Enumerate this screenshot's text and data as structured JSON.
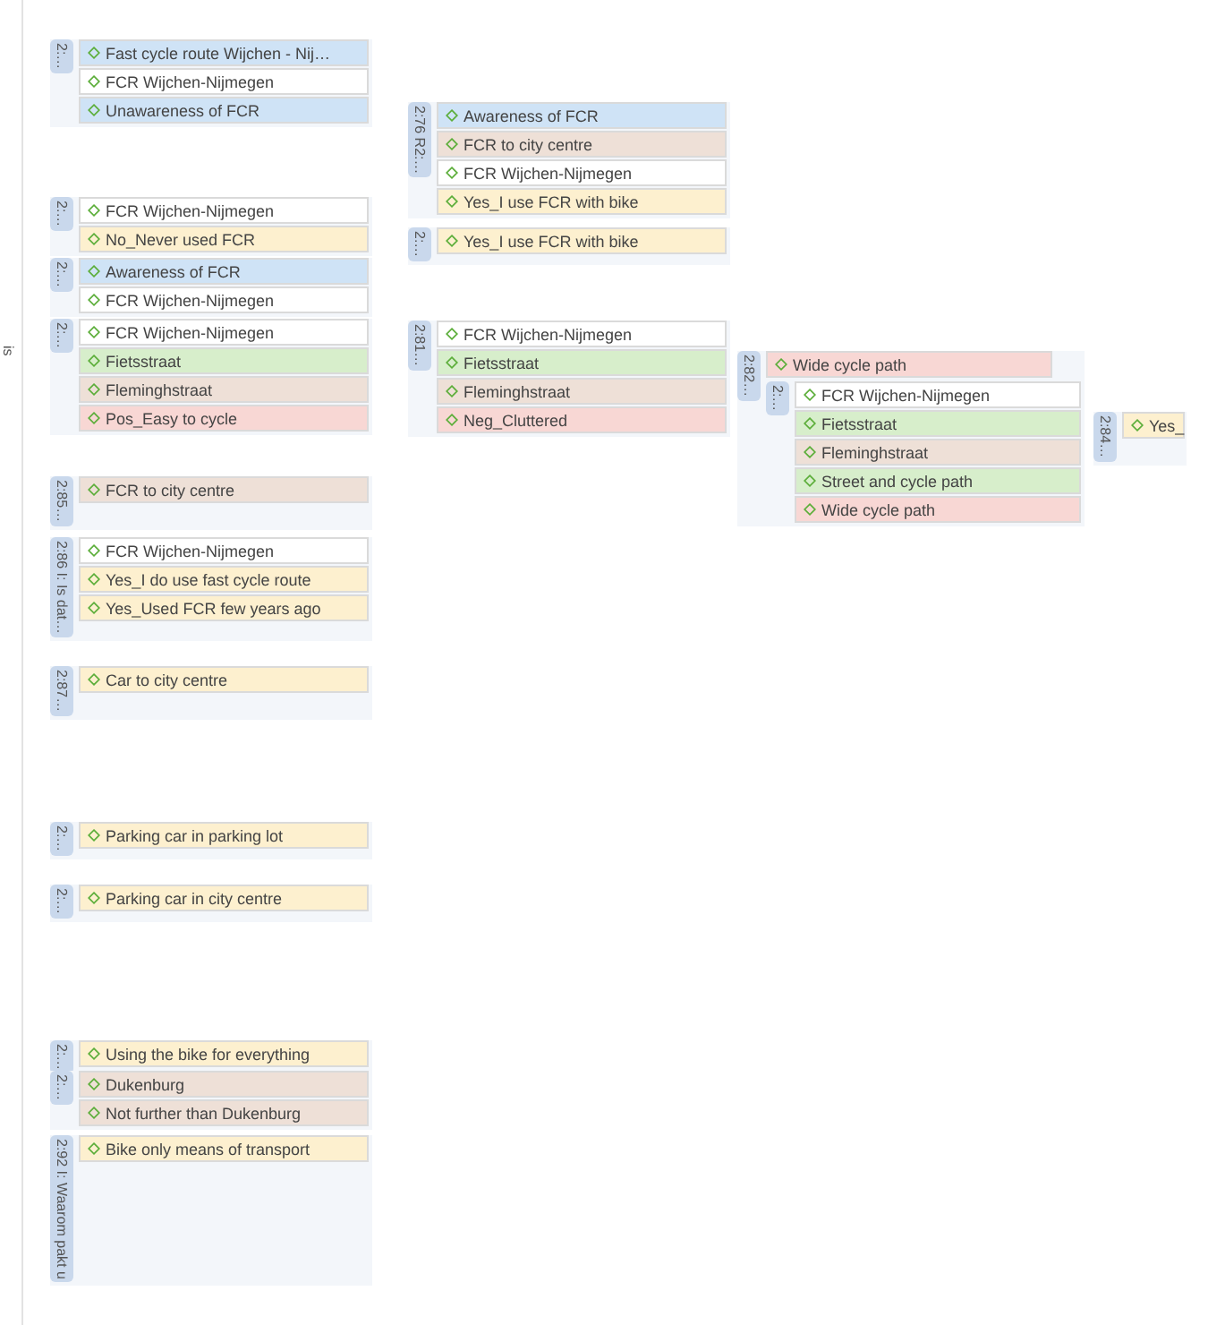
{
  "margin_text": "is",
  "groups": [
    {
      "label": "2:…",
      "codes": [
        {
          "text": "Fast cycle route Wijchen - Nij…",
          "color": "#cfe3f6"
        },
        {
          "text": "FCR Wijchen-Nijmegen",
          "color": "#ffffff"
        },
        {
          "text": "Unawareness of FCR",
          "color": "#cfe3f6"
        }
      ]
    },
    {
      "label": "2:…",
      "codes": [
        {
          "text": "FCR Wijchen-Nijmegen",
          "color": "#ffffff"
        },
        {
          "text": "No_Never used FCR",
          "color": "#fdf0cf"
        }
      ]
    },
    {
      "label": "2:…",
      "codes": [
        {
          "text": "Awareness of FCR",
          "color": "#cfe3f6"
        },
        {
          "text": "FCR Wijchen-Nijmegen",
          "color": "#ffffff"
        }
      ]
    },
    {
      "label": "2:…",
      "codes": [
        {
          "text": "FCR Wijchen-Nijmegen",
          "color": "#ffffff"
        },
        {
          "text": "Fietsstraat",
          "color": "#d7eecb"
        },
        {
          "text": "Fleminghstraat",
          "color": "#eee0d7"
        },
        {
          "text": "Pos_Easy to cycle",
          "color": "#f8d7d4"
        }
      ]
    },
    {
      "label": "2:85…",
      "codes": [
        {
          "text": "FCR to city centre",
          "color": "#eee0d7"
        }
      ]
    },
    {
      "label": "2:86 I: Is dat…",
      "codes": [
        {
          "text": "FCR Wijchen-Nijmegen",
          "color": "#ffffff"
        },
        {
          "text": "Yes_I do use fast cycle route",
          "color": "#fdf0cf"
        },
        {
          "text": "Yes_Used FCR few years ago",
          "color": "#fdf0cf"
        }
      ]
    },
    {
      "label": "2:87…",
      "codes": [
        {
          "text": "Car to city centre",
          "color": "#fdf0cf"
        }
      ]
    },
    {
      "label": "2:…",
      "codes": [
        {
          "text": "Parking car in parking lot",
          "color": "#fdf0cf"
        }
      ]
    },
    {
      "label": "2:…",
      "codes": [
        {
          "text": "Parking car in city centre",
          "color": "#fdf0cf"
        }
      ]
    },
    {
      "label": "2:…",
      "codes": [
        {
          "text": "Using the bike for everything",
          "color": "#fdf0cf"
        }
      ]
    },
    {
      "label": "2:…",
      "codes": [
        {
          "text": "Dukenburg",
          "color": "#eee0d7"
        },
        {
          "text": "Not further than Dukenburg",
          "color": "#eee0d7"
        }
      ]
    },
    {
      "label": "2:92 I: Waarom pakt u",
      "codes": [
        {
          "text": "Bike only means of transport",
          "color": "#fdf0cf"
        }
      ]
    },
    {
      "label": "2:76 R2:…",
      "codes": [
        {
          "text": "Awareness of FCR",
          "color": "#cfe3f6"
        },
        {
          "text": "FCR to city centre",
          "color": "#eee0d7"
        },
        {
          "text": "FCR Wijchen-Nijmegen",
          "color": "#ffffff"
        },
        {
          "text": "Yes_I use FCR with bike",
          "color": "#fdf0cf"
        }
      ]
    },
    {
      "label": "2:…",
      "codes": [
        {
          "text": "Yes_I use FCR with bike",
          "color": "#fdf0cf"
        }
      ]
    },
    {
      "label": "2:81…",
      "codes": [
        {
          "text": "FCR Wijchen-Nijmegen",
          "color": "#ffffff"
        },
        {
          "text": "Fietsstraat",
          "color": "#d7eecb"
        },
        {
          "text": "Fleminghstraat",
          "color": "#eee0d7"
        },
        {
          "text": "Neg_Cluttered",
          "color": "#f8d7d4"
        }
      ]
    },
    {
      "label": "2:82…",
      "codes": [
        {
          "text": "Wide cycle path",
          "color": "#f8d7d4"
        }
      ],
      "children": [
        {
          "label": "2:…",
          "codes": [
            {
              "text": "FCR Wijchen-Nijmegen",
              "color": "#ffffff"
            },
            {
              "text": "Fietsstraat",
              "color": "#d7eecb"
            },
            {
              "text": "Fleminghstraat",
              "color": "#eee0d7"
            },
            {
              "text": "Street and cycle path",
              "color": "#d7eecb"
            },
            {
              "text": "Wide cycle path",
              "color": "#f8d7d4"
            }
          ]
        }
      ]
    },
    {
      "label": "2:84…",
      "codes": [
        {
          "text": "Yes_",
          "color": "#fdf0cf"
        }
      ]
    }
  ]
}
